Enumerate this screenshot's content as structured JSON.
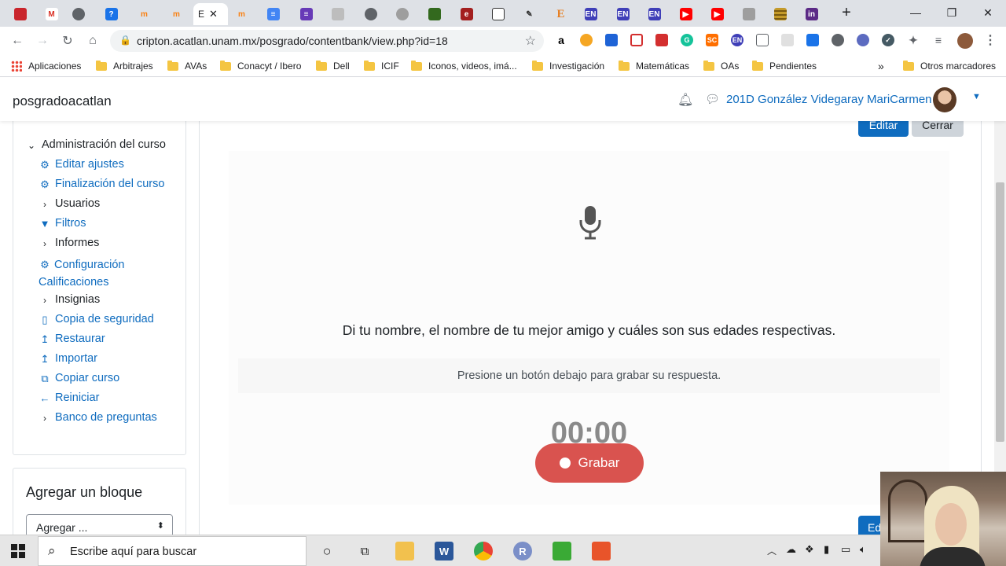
{
  "browser": {
    "active_tab_label": "E",
    "tab_icons": [
      "adobe-icon",
      "gmail-icon",
      "chrome-icon",
      "zoom-icon",
      "moodle-icon",
      "moodle-icon",
      "moodle-icon",
      "docs-icon",
      "forms-icon",
      "pdf-icon",
      "chrome-icon",
      "cursive-icon",
      "tree-icon",
      "e-icon",
      "bookmark-icon",
      "pen-icon",
      "e-letter-icon",
      "en-icon",
      "en-icon",
      "en-icon",
      "youtube-icon",
      "youtube-icon",
      "image-icon",
      "stripes-icon",
      "in-icon"
    ],
    "new_tab_symbol": "+",
    "url": "cripton.acatlan.unam.mx/posgrado/contentbank/view.php?id=18",
    "window": {
      "minimize": "—",
      "restore": "❐",
      "close": "✕"
    },
    "bookmarks": [
      {
        "label": "Aplicaciones",
        "type": "apps"
      },
      {
        "label": "Arbitrajes",
        "type": "folder"
      },
      {
        "label": "AVAs",
        "type": "folder"
      },
      {
        "label": "Conacyt / Ibero",
        "type": "folder"
      },
      {
        "label": "Dell",
        "type": "folder"
      },
      {
        "label": "ICIF",
        "type": "folder"
      },
      {
        "label": "Iconos, videos, imá...",
        "type": "folder"
      },
      {
        "label": "Investigación",
        "type": "folder"
      },
      {
        "label": "Matemáticas",
        "type": "folder"
      },
      {
        "label": "OAs",
        "type": "folder"
      },
      {
        "label": "Pendientes",
        "type": "folder"
      }
    ],
    "bookmarks_overflow": "»",
    "other_bookmarks": "Otros marcadores"
  },
  "navbar": {
    "brand": "posgradoacatlan",
    "user": "201D González Videgaray MariCarmen"
  },
  "sidebar": {
    "section_title": "Administración del curso",
    "items": [
      {
        "label": "Editar ajustes",
        "icon": "gear-icon",
        "kind": "link"
      },
      {
        "label": "Finalización del curso",
        "icon": "gear-icon",
        "kind": "link"
      },
      {
        "label": "Usuarios",
        "icon": "chevron-right-icon",
        "kind": "folder"
      },
      {
        "label": "Filtros",
        "icon": "filter-icon",
        "kind": "link"
      },
      {
        "label": "Informes",
        "icon": "chevron-right-icon",
        "kind": "folder"
      },
      {
        "label": "Configuración Calificaciones",
        "icon": "gear-icon",
        "kind": "link"
      },
      {
        "label": "Insignias",
        "icon": "chevron-right-icon",
        "kind": "folder"
      },
      {
        "label": "Copia de seguridad",
        "icon": "file-icon",
        "kind": "link"
      },
      {
        "label": "Restaurar",
        "icon": "upload-icon",
        "kind": "link"
      },
      {
        "label": "Importar",
        "icon": "upload-icon",
        "kind": "link"
      },
      {
        "label": "Copiar curso",
        "icon": "copy-icon",
        "kind": "link"
      },
      {
        "label": "Reiniciar",
        "icon": "arrow-left-icon",
        "kind": "link"
      },
      {
        "label": "Banco de preguntas",
        "icon": "chevron-right-icon",
        "kind": "folder"
      }
    ]
  },
  "add_block": {
    "title": "Agregar un bloque",
    "select_value": "Agregar ..."
  },
  "main": {
    "edit_label": "Editar",
    "close_label": "Cerrar",
    "bottom_edit_label": "Ed",
    "question": "Di tu nombre, el nombre de tu mejor amigo y cuáles son sus edades respectivas.",
    "hint": "Presione un botón debajo para grabar su respuesta.",
    "timer": "00:00",
    "record_label": "Grabar"
  },
  "taskbar": {
    "search_placeholder": "Escribe aquí para buscar"
  },
  "colors": {
    "link": "#0f6cbf",
    "primary_button": "#0f6cbf",
    "record_button": "#d9534f",
    "secondary_button": "#ced4da"
  }
}
